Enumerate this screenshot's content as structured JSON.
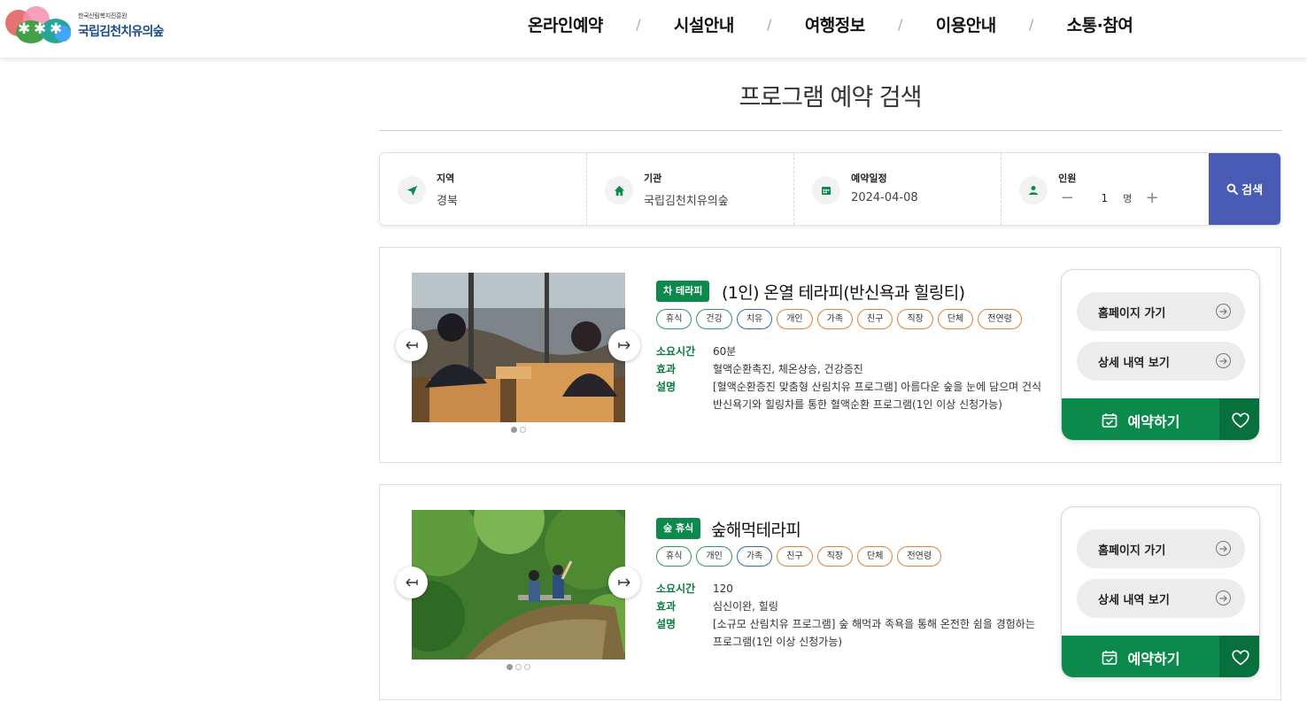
{
  "header": {
    "logo_subtitle": "한국산림복지진흥원",
    "logo_name": "국립김천치유의숲",
    "nav": [
      "온라인예약",
      "시설안내",
      "여행정보",
      "이용안내",
      "소통·참여"
    ],
    "separator": "/"
  },
  "page_title": "프로그램 예약 검색",
  "search": {
    "region": {
      "label": "지역",
      "value": "경북"
    },
    "institution": {
      "label": "기관",
      "value": "국립김천치유의숲"
    },
    "date": {
      "label": "예약일정",
      "value": "2024-04-08"
    },
    "people": {
      "label": "인원",
      "minus": "−",
      "count": "1",
      "unit": "명",
      "plus": "+"
    },
    "button_label": "검색"
  },
  "colors": {
    "brand_green": "#0b8a4c",
    "search_blue": "#4a5bb5"
  },
  "programs": [
    {
      "badge": "차 테라피",
      "title": "(1인) 온열 테라피(반신욕과 힐링티)",
      "tags": [
        "휴식",
        "건강",
        "치유",
        "개인",
        "가족",
        "친구",
        "직장",
        "단체",
        "전연령"
      ],
      "duration_label": "소요시간",
      "duration": "60분",
      "effect_label": "효과",
      "effect": "혈액순환촉진, 체온상승, 건강증진",
      "desc_label": "설명",
      "description": "[혈액순환증진 맞춤형 산림치유 프로그램] 아름다운 숲을 눈에 담으며 건식반신욕기와 힐링차를 통한 혈액순환 프로그램(1인 이상 신청가능)",
      "slides": 2,
      "homepage_label": "홈페이지 가기",
      "detail_label": "상세 내역 보기",
      "reserve_label": "예약하기"
    },
    {
      "badge": "숲 휴식",
      "title": "숲해먹테라피",
      "tags": [
        "휴식",
        "개인",
        "가족",
        "친구",
        "직장",
        "단체",
        "전연령"
      ],
      "duration_label": "소요시간",
      "duration": "120",
      "effect_label": "효과",
      "effect": "심신이완, 힐링",
      "desc_label": "설명",
      "description": "[소규모 산림치유 프로그램] 숲 해먹과 족욕을 통해 온전한 쉼을 경험하는 프로그램(1인 이상 신청가능)",
      "slides": 3,
      "homepage_label": "홈페이지 가기",
      "detail_label": "상세 내역 보기",
      "reserve_label": "예약하기"
    }
  ]
}
